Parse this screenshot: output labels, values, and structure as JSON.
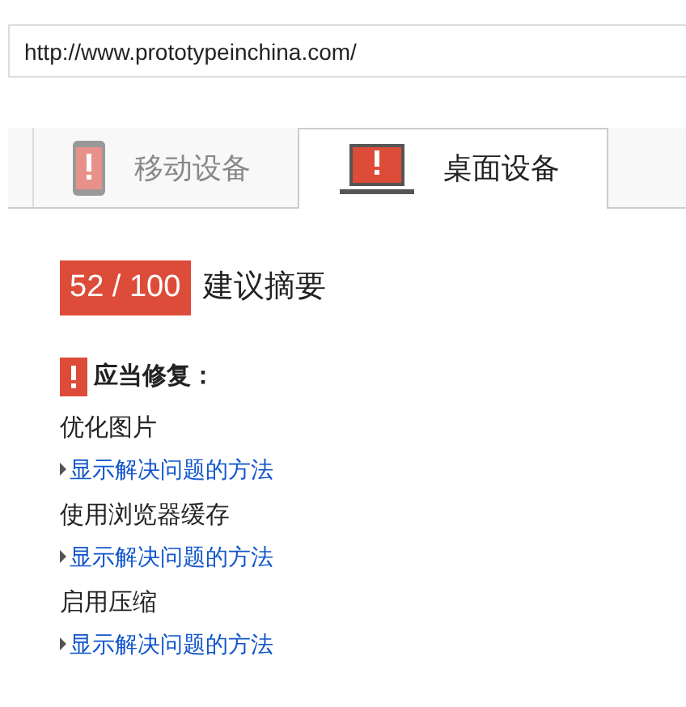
{
  "url_field": {
    "value": "http://www.prototypeinchina.com/"
  },
  "tabs": [
    {
      "kind": "mobile",
      "label": "移动设备",
      "selected": false
    },
    {
      "kind": "desktop",
      "label": "桌面设备",
      "selected": true
    }
  ],
  "score": {
    "value": "52 / 100",
    "title": "建议摘要"
  },
  "section": {
    "heading": "应当修复："
  },
  "rules": [
    {
      "name": "优化图片",
      "link": "显示解决问题的方法"
    },
    {
      "name": "使用浏览器缓存",
      "link": "显示解决问题的方法"
    },
    {
      "name": "启用压缩",
      "link": "显示解决问题的方法"
    }
  ]
}
